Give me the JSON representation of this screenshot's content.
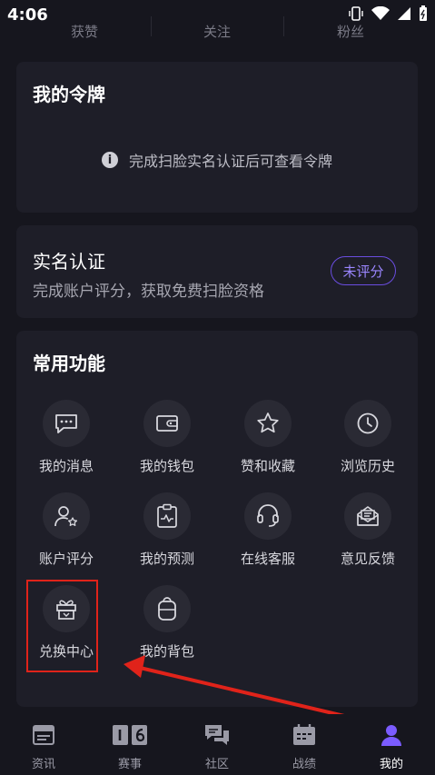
{
  "status": {
    "time": "4:06"
  },
  "stats": {
    "likes_label": "获赞",
    "follows_label": "关注",
    "fans_label": "粉丝"
  },
  "token_card": {
    "title": "我的令牌",
    "notice": "完成扫脸实名认证后可查看令牌"
  },
  "realname_card": {
    "title": "实名认证",
    "subtitle": "完成账户评分，获取免费扫脸资格",
    "badge": "未评分"
  },
  "functions": {
    "title": "常用功能",
    "items": [
      {
        "label": "我的消息",
        "icon": "message-icon"
      },
      {
        "label": "我的钱包",
        "icon": "wallet-icon"
      },
      {
        "label": "赞和收藏",
        "icon": "star-icon"
      },
      {
        "label": "浏览历史",
        "icon": "clock-icon"
      },
      {
        "label": "账户评分",
        "icon": "user-star-icon"
      },
      {
        "label": "我的预测",
        "icon": "clipboard-chart-icon"
      },
      {
        "label": "在线客服",
        "icon": "headset-icon"
      },
      {
        "label": "意见反馈",
        "icon": "feedback-mail-icon"
      },
      {
        "label": "兑换中心",
        "icon": "gift-icon"
      },
      {
        "label": "我的背包",
        "icon": "backpack-icon"
      }
    ]
  },
  "tabs": [
    {
      "label": "资讯",
      "icon": "news-icon"
    },
    {
      "label": "赛事",
      "icon": "scoreboard-icon"
    },
    {
      "label": "社区",
      "icon": "chat-icon"
    },
    {
      "label": "战绩",
      "icon": "calendar-icon"
    },
    {
      "label": "我的",
      "icon": "profile-icon"
    }
  ],
  "colors": {
    "accent": "#6a4de0",
    "highlight": "#e0231a",
    "card": "#1e1e28",
    "background": "#16161e"
  }
}
